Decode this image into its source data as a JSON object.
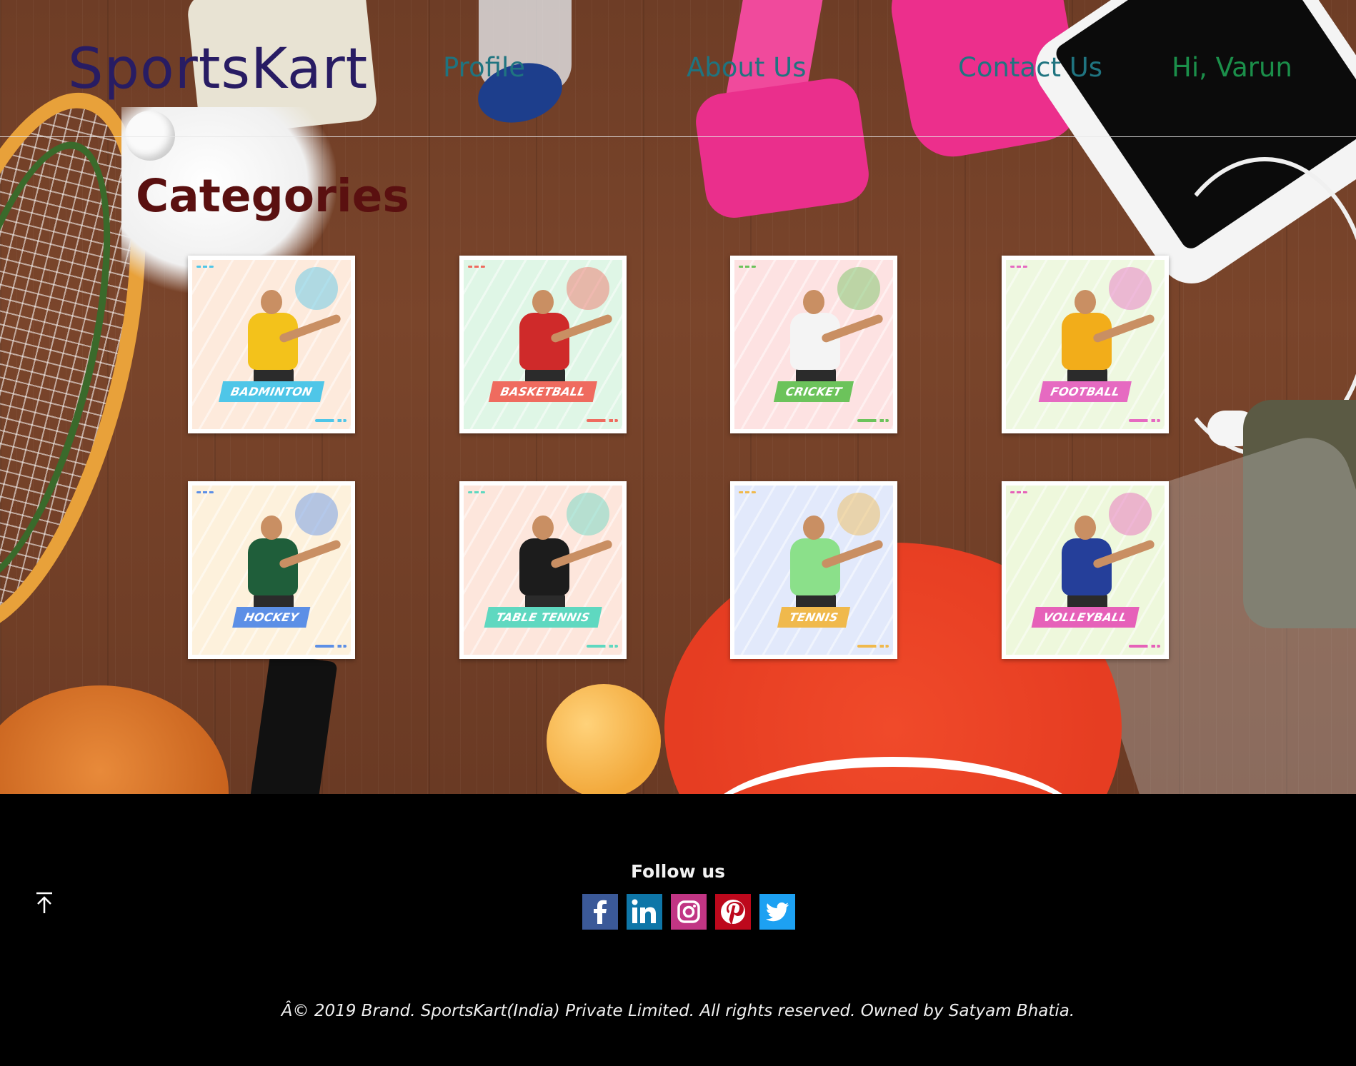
{
  "header": {
    "brand": "SportsKart",
    "nav": {
      "profile": "Profile",
      "about": "About Us",
      "contact": "Contact Us"
    },
    "greeting": "Hi, Varun"
  },
  "main": {
    "title": "Categories",
    "categories": [
      {
        "label": "BADMINTON",
        "tag_color": "#4fc6e8",
        "tint": "#fdeadc",
        "shirt": "#f3c21b"
      },
      {
        "label": "BASKETBALL",
        "tag_color": "#ef6b5f",
        "tint": "#dff6e6",
        "shirt": "#cf2a2a"
      },
      {
        "label": "CRICKET",
        "tag_color": "#6cc35b",
        "tint": "#fde2e2",
        "shirt": "#f4f4f4"
      },
      {
        "label": "FOOTBALL",
        "tag_color": "#e66ac1",
        "tint": "#eef8e0",
        "shirt": "#f2ad1a"
      },
      {
        "label": "HOCKEY",
        "tag_color": "#5c8fe6",
        "tint": "#fdf1dc",
        "shirt": "#1f5e3a"
      },
      {
        "label": "TABLE TENNIS",
        "tag_color": "#5fd8c0",
        "tint": "#fde6dc",
        "shirt": "#1c1c1c"
      },
      {
        "label": "TENNIS",
        "tag_color": "#f0b94c",
        "tint": "#e2e9fb",
        "shirt": "#8be08a"
      },
      {
        "label": "VOLLEYBALL",
        "tag_color": "#e661b9",
        "tint": "#eef8dc",
        "shirt": "#253f9a"
      }
    ]
  },
  "footer": {
    "follow_label": "Follow us",
    "socials": [
      {
        "name": "facebook",
        "color": "#3b5998"
      },
      {
        "name": "linkedin",
        "color": "#0e76a8"
      },
      {
        "name": "instagram",
        "color": "#c13584"
      },
      {
        "name": "pinterest",
        "color": "#bd081c"
      },
      {
        "name": "twitter",
        "color": "#1da1f2"
      }
    ],
    "copyright": "Â© 2019 Brand. SportsKart(India) Private Limited. All rights reserved. Owned by Satyam Bhatia."
  }
}
